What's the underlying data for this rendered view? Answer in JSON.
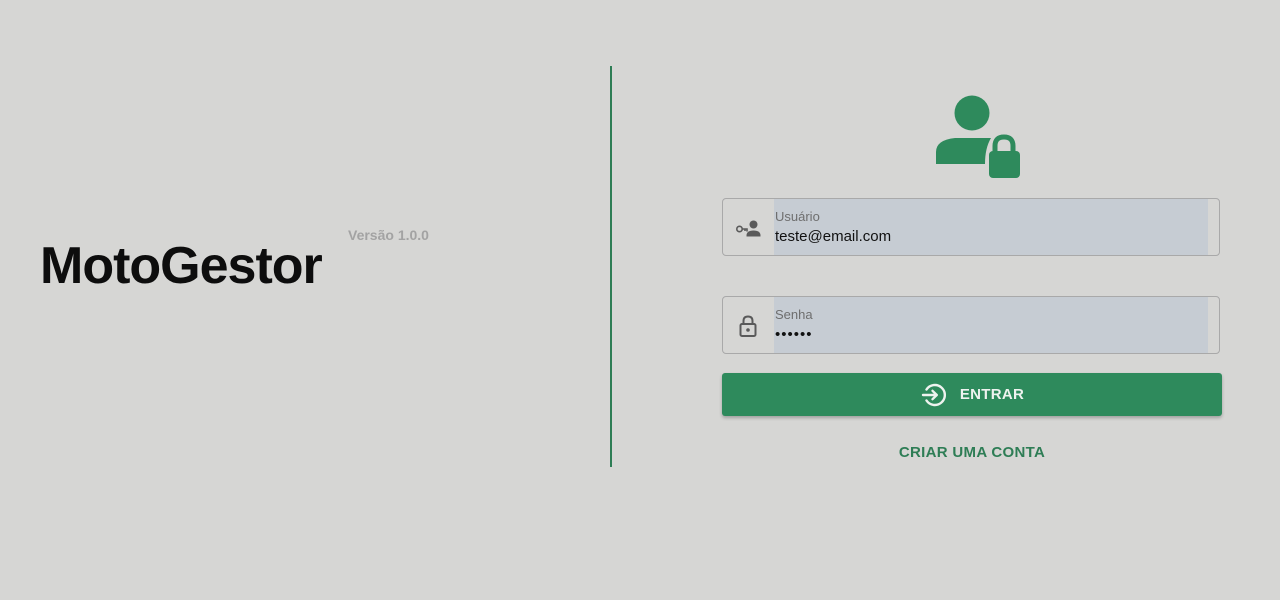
{
  "app": {
    "title": "MotoGestor",
    "version": "Versão 1.0.0"
  },
  "login": {
    "hero_icon": "person-lock-icon",
    "username": {
      "label": "Usuário",
      "value": "teste@email.com",
      "icon": "key-person-icon"
    },
    "password": {
      "label": "Senha",
      "value": "••••••",
      "icon": "lock-icon"
    },
    "submit": {
      "label": "ENTRAR",
      "icon": "login-icon"
    },
    "create_account_label": "CRIAR UMA CONTA"
  },
  "colors": {
    "background": "#d6d6d4",
    "accent": "#2e8a5c",
    "divider": "#2e7d55",
    "field_fill": "#c6ccd3"
  }
}
